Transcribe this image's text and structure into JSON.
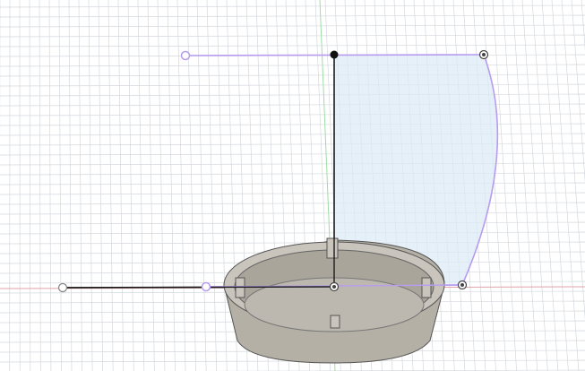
{
  "viewport": {
    "background": "#ffffff",
    "grid_color": "#d4d8dd",
    "x_axis_color": "#e0a3a8",
    "y_axis_color": "#9fdca6",
    "sketch_color": "#b79cf0",
    "constraint_color": "#1a1a1a",
    "profile_fill": "#dcebf6",
    "model_color": "#b5b0a6"
  },
  "sketch": {
    "points": [
      {
        "name": "top-left-endpoint-icon"
      },
      {
        "name": "top-center-point-icon"
      },
      {
        "name": "top-right-point-icon"
      },
      {
        "name": "left-endpoint-icon"
      },
      {
        "name": "mid-left-point-icon"
      },
      {
        "name": "origin-point-icon"
      },
      {
        "name": "bottom-right-point-icon"
      }
    ]
  }
}
